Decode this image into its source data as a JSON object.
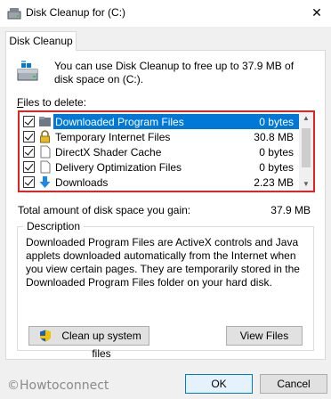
{
  "window": {
    "title": "Disk Cleanup for  (C:)",
    "close_glyph": "✕"
  },
  "tabs": [
    {
      "label": "Disk Cleanup"
    }
  ],
  "intro": {
    "text": "You can use Disk Cleanup to free up to 37.9 MB of disk space on  (C:)."
  },
  "files": {
    "label_prefix": "F",
    "label_rest": "iles to delete:",
    "items": [
      {
        "name": "Downloaded Program Files",
        "size": "0 bytes",
        "checked": true,
        "selected": true,
        "icon": "folder-icon"
      },
      {
        "name": "Temporary Internet Files",
        "size": "30.8 MB",
        "checked": true,
        "selected": false,
        "icon": "lock-icon"
      },
      {
        "name": "DirectX Shader Cache",
        "size": "0 bytes",
        "checked": true,
        "selected": false,
        "icon": "file-icon"
      },
      {
        "name": "Delivery Optimization Files",
        "size": "0 bytes",
        "checked": true,
        "selected": false,
        "icon": "file-icon"
      },
      {
        "name": "Downloads",
        "size": "2.23 MB",
        "checked": true,
        "selected": false,
        "icon": "download-arrow-icon"
      }
    ]
  },
  "total": {
    "label": "Total amount of disk space you gain:",
    "value": "37.9 MB"
  },
  "description": {
    "title": "Description",
    "text": "Downloaded Program Files are ActiveX controls and Java applets downloaded automatically from the Internet when you view certain pages. They are temporarily stored in the Downloaded Program Files folder on your hard disk."
  },
  "buttons": {
    "cleanup_system": "Clean up system files",
    "view_files": "View Files",
    "ok": "OK",
    "cancel": "Cancel"
  },
  "watermark": "©Howtoconnect",
  "colors": {
    "selection": "#0078d7",
    "highlight_border": "#e02424"
  }
}
